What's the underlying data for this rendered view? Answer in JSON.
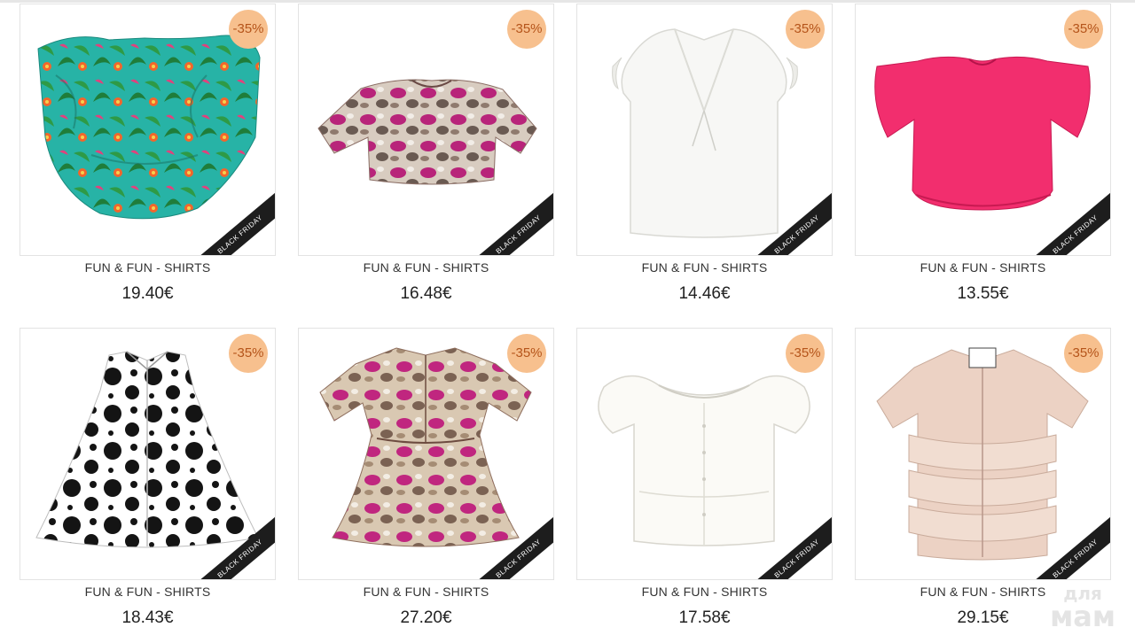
{
  "colors": {
    "badge_bg": "#f7c08e",
    "badge_text": "#b5541a",
    "ribbon_bg": "#1d1d1d",
    "border": "#e3e3e3"
  },
  "products": [
    {
      "discount": "-35%",
      "ribbon": "BLACK FRIDAY",
      "name": "FUN & FUN - SHIRTS",
      "price": "19.40€",
      "image": "tropical-print-ruffle-top"
    },
    {
      "discount": "-35%",
      "ribbon": "BLACK FRIDAY",
      "name": "FUN & FUN - SHIRTS",
      "price": "16.48€",
      "image": "snake-print-crop-top"
    },
    {
      "discount": "-35%",
      "ribbon": "BLACK FRIDAY",
      "name": "FUN & FUN - SHIRTS",
      "price": "14.46€",
      "image": "white-ruffle-collar-top"
    },
    {
      "discount": "-35%",
      "ribbon": "BLACK FRIDAY",
      "name": "FUN & FUN - SHIRTS",
      "price": "13.55€",
      "image": "pink-flutter-sleeve-top"
    },
    {
      "discount": "-35%",
      "ribbon": "BLACK FRIDAY",
      "name": "FUN & FUN - SHIRTS",
      "price": "18.43€",
      "image": "polka-dot-sleeveless-shirt"
    },
    {
      "discount": "-35%",
      "ribbon": "BLACK FRIDAY",
      "name": "FUN & FUN - SHIRTS",
      "price": "27.20€",
      "image": "snake-print-shirt-dress"
    },
    {
      "discount": "-35%",
      "ribbon": "BLACK FRIDAY",
      "name": "FUN & FUN - SHIRTS",
      "price": "17.58€",
      "image": "white-puff-sleeve-top"
    },
    {
      "discount": "-35%",
      "ribbon": "BLACK FRIDAY",
      "name": "FUN & FUN - SHIRTS",
      "price": "29.15€",
      "image": "blush-tiered-ruffle-shirt"
    }
  ],
  "watermark": {
    "line1": "для",
    "line2": "мам"
  }
}
